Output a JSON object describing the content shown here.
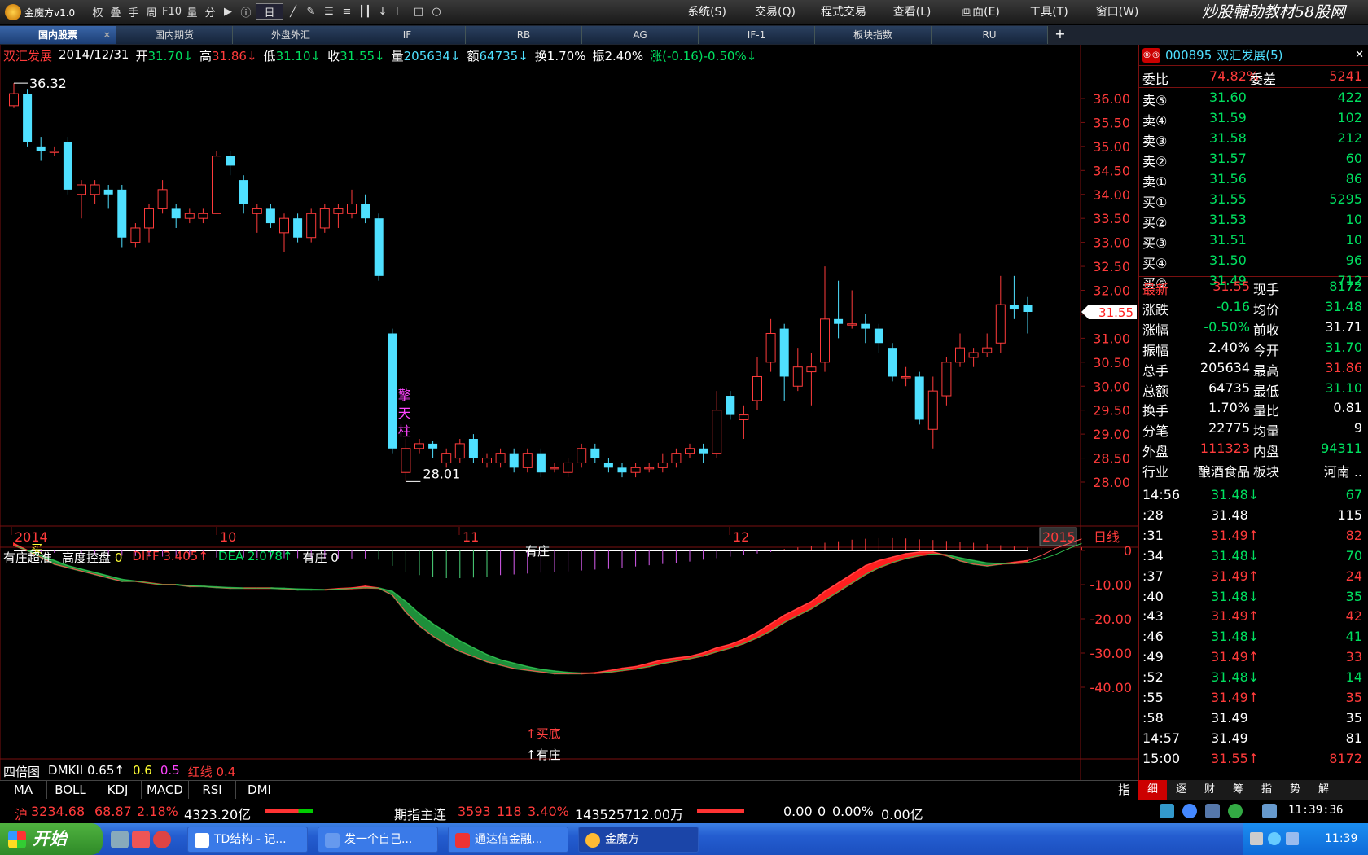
{
  "app": {
    "title": "金魔方v1.0",
    "brand": "炒股輔助教材58股网 www.58Gu.com"
  },
  "toolbar": {
    "items": [
      "权",
      "叠",
      "手",
      "周",
      "F10",
      "量",
      "分",
      "停",
      "选",
      "十"
    ],
    "cycle": "日"
  },
  "menus": [
    "系统(S)",
    "交易(Q)",
    "程式交易",
    "查看(L)",
    "画面(E)",
    "工具(T)",
    "窗口(W)"
  ],
  "tabs": [
    "国内股票",
    "国内期货",
    "外盘外汇",
    "IF",
    "RB",
    "AG",
    "IF-1",
    "板块指数",
    "RU"
  ],
  "info": {
    "stock": "双汇发展",
    "date": "2014/12/31",
    "open_l": "开",
    "open": "31.70↓",
    "high_l": "高",
    "high": "31.86↓",
    "low_l": "低",
    "low": "31.10↓",
    "close_l": "收",
    "close": "31.55↓",
    "vol_l": "量",
    "vol": "205634↓",
    "amt_l": "额",
    "amt": "64735↓",
    "turn_l": "换",
    "turn": "1.70%",
    "amp_l": "振",
    "amp": "2.40%",
    "chg": "涨(-0.16)-0.50%↓"
  },
  "annotations": {
    "max": "36.32",
    "min": "28.01",
    "qt_chars": [
      "擎",
      "天",
      "柱"
    ],
    "last_price": "31.55",
    "youzhuang": "有庄",
    "maidi": "↑买底",
    "youzhuang2": "↑有庄",
    "mai": "买"
  },
  "chart_data": {
    "type": "candlestick",
    "ylim": [
      28.0,
      36.5
    ],
    "y_ticks": [
      "36.00",
      "35.50",
      "35.00",
      "34.50",
      "34.00",
      "33.50",
      "33.00",
      "32.50",
      "32.00",
      "31.50",
      "31.00",
      "30.50",
      "30.00",
      "29.50",
      "29.00",
      "28.50",
      "28.00"
    ],
    "x_labels": [
      "2014",
      "10",
      "11",
      "12",
      "2015"
    ],
    "period": "日线",
    "candles": [
      [
        35.85,
        36.1,
        36.32,
        35.8
      ],
      [
        36.1,
        35.1,
        36.2,
        35.0
      ],
      [
        35.0,
        34.9,
        35.2,
        34.7
      ],
      [
        34.9,
        34.9,
        35.0,
        34.8
      ],
      [
        35.1,
        34.1,
        35.2,
        34.0
      ],
      [
        34.0,
        34.2,
        34.3,
        33.5
      ],
      [
        34.0,
        34.2,
        34.3,
        33.8
      ],
      [
        34.1,
        34.0,
        34.2,
        33.7
      ],
      [
        34.1,
        33.1,
        34.2,
        32.9
      ],
      [
        33.0,
        33.3,
        33.4,
        32.9
      ],
      [
        33.3,
        33.7,
        33.8,
        33.0
      ],
      [
        33.7,
        34.1,
        34.3,
        33.6
      ],
      [
        33.7,
        33.5,
        33.8,
        33.3
      ],
      [
        33.5,
        33.6,
        33.7,
        33.4
      ],
      [
        33.5,
        33.6,
        33.7,
        33.4
      ],
      [
        33.6,
        34.8,
        34.9,
        33.6
      ],
      [
        34.8,
        34.6,
        34.9,
        34.4
      ],
      [
        34.3,
        33.8,
        34.4,
        33.6
      ],
      [
        33.6,
        33.7,
        33.8,
        33.2
      ],
      [
        33.7,
        33.4,
        33.8,
        33.3
      ],
      [
        33.2,
        33.5,
        33.6,
        32.8
      ],
      [
        33.5,
        33.1,
        33.6,
        33.0
      ],
      [
        33.1,
        33.6,
        33.7,
        33.0
      ],
      [
        33.3,
        33.7,
        33.8,
        33.2
      ],
      [
        33.6,
        33.7,
        33.8,
        33.3
      ],
      [
        33.6,
        33.8,
        34.1,
        33.5
      ],
      [
        33.8,
        33.5,
        34.0,
        33.4
      ],
      [
        33.5,
        32.3,
        33.6,
        32.2
      ],
      [
        31.1,
        28.7,
        31.2,
        28.6
      ],
      [
        28.2,
        28.7,
        28.9,
        28.01
      ],
      [
        28.7,
        28.8,
        28.9,
        28.6
      ],
      [
        28.8,
        28.7,
        28.85,
        28.5
      ],
      [
        28.4,
        28.6,
        28.7,
        28.3
      ],
      [
        28.5,
        28.8,
        28.9,
        28.4
      ],
      [
        28.9,
        28.5,
        29.0,
        28.4
      ],
      [
        28.4,
        28.5,
        28.6,
        28.3
      ],
      [
        28.4,
        28.6,
        28.7,
        28.3
      ],
      [
        28.6,
        28.3,
        28.7,
        28.2
      ],
      [
        28.3,
        28.6,
        28.7,
        28.2
      ],
      [
        28.6,
        28.2,
        28.7,
        28.1
      ],
      [
        28.3,
        28.3,
        28.4,
        28.2
      ],
      [
        28.2,
        28.4,
        28.5,
        28.1
      ],
      [
        28.4,
        28.7,
        28.8,
        28.3
      ],
      [
        28.7,
        28.5,
        28.8,
        28.4
      ],
      [
        28.4,
        28.3,
        28.5,
        28.2
      ],
      [
        28.3,
        28.2,
        28.4,
        28.1
      ],
      [
        28.2,
        28.3,
        28.4,
        28.1
      ],
      [
        28.3,
        28.3,
        28.4,
        28.2
      ],
      [
        28.3,
        28.4,
        28.6,
        28.2
      ],
      [
        28.4,
        28.6,
        28.7,
        28.3
      ],
      [
        28.6,
        28.7,
        28.8,
        28.5
      ],
      [
        28.7,
        28.6,
        28.8,
        28.4
      ],
      [
        28.6,
        29.5,
        29.9,
        28.5
      ],
      [
        29.8,
        29.4,
        29.9,
        29.3
      ],
      [
        29.3,
        29.4,
        29.6,
        28.9
      ],
      [
        29.7,
        30.2,
        30.6,
        29.5
      ],
      [
        30.5,
        31.1,
        31.4,
        30.3
      ],
      [
        31.2,
        30.2,
        31.3,
        29.7
      ],
      [
        30.0,
        30.4,
        30.8,
        29.9
      ],
      [
        30.3,
        30.4,
        30.7,
        29.6
      ],
      [
        30.5,
        31.4,
        32.5,
        30.3
      ],
      [
        31.4,
        31.3,
        32.2,
        31.0
      ],
      [
        31.3,
        31.3,
        32.0,
        31.2
      ],
      [
        31.3,
        31.2,
        31.5,
        30.9
      ],
      [
        31.2,
        30.9,
        31.3,
        30.7
      ],
      [
        30.8,
        30.2,
        30.9,
        30.1
      ],
      [
        30.2,
        30.2,
        30.4,
        30.0
      ],
      [
        30.2,
        29.3,
        30.3,
        29.2
      ],
      [
        29.1,
        29.9,
        30.2,
        28.7
      ],
      [
        29.8,
        30.5,
        30.6,
        29.6
      ],
      [
        30.5,
        30.8,
        31.1,
        30.4
      ],
      [
        30.6,
        30.7,
        30.8,
        30.4
      ],
      [
        30.7,
        30.8,
        31.1,
        30.6
      ],
      [
        30.9,
        31.7,
        32.3,
        30.7
      ],
      [
        31.7,
        31.6,
        32.3,
        31.4
      ],
      [
        31.7,
        31.55,
        31.86,
        31.1
      ]
    ]
  },
  "indicator": {
    "name": "有庄超准",
    "p1_l": "高度控盘",
    "p1": "0",
    "diff_l": "DIFF",
    "diff": "3.405↑",
    "dea_l": "DEA",
    "dea": "2.078↑",
    "yz_l": "有庄",
    "yz": "0",
    "y_ticks": [
      "0",
      "-10.00",
      "-20.00",
      "-30.00",
      "-40.00"
    ],
    "diff_series": [
      2,
      0,
      -2,
      -4,
      -5,
      -6,
      -7,
      -8,
      -9,
      -9,
      -9.5,
      -10,
      -10,
      -10.5,
      -10.5,
      -10.8,
      -11,
      -11,
      -11,
      -11,
      -11.2,
      -11.5,
      -11.5,
      -11.5,
      -11.2,
      -11,
      -10.5,
      -11,
      -13,
      -18,
      -22,
      -25,
      -27.5,
      -29.5,
      -31,
      -32.5,
      -33.5,
      -34.5,
      -35,
      -35.5,
      -36,
      -36,
      -36,
      -35.8,
      -35.2,
      -34.5,
      -34,
      -33,
      -32,
      -31.5,
      -31,
      -30,
      -28.5,
      -27.5,
      -26,
      -24,
      -21.5,
      -19,
      -17,
      -15,
      -12,
      -9.5,
      -7,
      -4.5,
      -3,
      -2,
      -1,
      -0.5,
      -0.5,
      -1.5,
      -3,
      -4,
      -4.5,
      -4,
      -3.5,
      -3,
      -1.5,
      0.5,
      2,
      3.4
    ],
    "dea_series": [
      1.5,
      0,
      -1.5,
      -3,
      -4.5,
      -5.5,
      -6.5,
      -7.5,
      -8.5,
      -9,
      -9.5,
      -10,
      -10,
      -10.3,
      -10.5,
      -10.7,
      -10.9,
      -11,
      -11,
      -11,
      -11.1,
      -11.3,
      -11.4,
      -11.5,
      -11.3,
      -11.1,
      -10.9,
      -11,
      -12,
      -15,
      -18.5,
      -21.5,
      -24,
      -26.5,
      -28.5,
      -30.5,
      -32,
      -33,
      -34,
      -34.8,
      -35.3,
      -35.7,
      -35.9,
      -35.9,
      -35.6,
      -35.1,
      -34.6,
      -33.9,
      -33,
      -32.3,
      -31.6,
      -30.8,
      -29.6,
      -28.5,
      -27.2,
      -25.5,
      -23.5,
      -21,
      -19,
      -17,
      -14.5,
      -12,
      -9.5,
      -7,
      -5,
      -3.5,
      -2.3,
      -1.5,
      -1,
      -1.3,
      -2.2,
      -3,
      -3.7,
      -3.9,
      -3.8,
      -3.5,
      -2.6,
      -1.3,
      0.5,
      2.08
    ],
    "bars": [
      0,
      0,
      -0.5,
      -0.8,
      -1,
      -1.2,
      -1.5,
      -1.5,
      -1.7,
      -1.8,
      -2,
      -2,
      -2,
      -2.1,
      -2.2,
      -2.3,
      -2.3,
      -2.3,
      -2.4,
      -2.4,
      -2.5,
      -2.5,
      -2.6,
      -2.6,
      -2.6,
      -2.6,
      -2.6,
      -3,
      -5,
      -7,
      -8,
      -8.5,
      -9,
      -9,
      -8.8,
      -8.5,
      -8,
      -7.8,
      -7.5,
      -7.2,
      -7,
      -6.8,
      -6.5,
      -6.2,
      -6,
      -5.6,
      -5.2,
      -4.8,
      -4.4,
      -4,
      -3.6,
      -3,
      -2.5,
      -2,
      -1.5,
      -1,
      -0.5,
      0.5,
      1,
      1.5,
      2.5,
      3,
      3.5,
      3.8,
      4,
      4,
      3.9,
      3.6,
      3.4,
      3.1,
      2.8,
      2.5,
      2.1,
      1.7,
      1.3,
      1,
      0.8,
      0.6,
      0.8,
      1
    ]
  },
  "indicator2": {
    "name": "四倍图",
    "dmk_l": "DMKII",
    "dmk": "0.65↑",
    "v2": "0.6",
    "v3": "0.5",
    "hx_l": "红线",
    "hx": "0.4"
  },
  "ind_tabs": [
    "MA",
    "BOLL",
    "KDJ",
    "MACD",
    "RSI",
    "DMI"
  ],
  "ind_tab_zhi": "指",
  "quote": {
    "code": "000895",
    "name": "双汇发展(5)",
    "wb_l": "委比",
    "wb": "74.82%",
    "wc_l": "委差",
    "wc": "5241",
    "sells": [
      [
        "卖⑤",
        "31.60",
        "422"
      ],
      [
        "卖④",
        "31.59",
        "102"
      ],
      [
        "卖③",
        "31.58",
        "212"
      ],
      [
        "卖②",
        "31.57",
        "60"
      ],
      [
        "卖①",
        "31.56",
        "86"
      ]
    ],
    "buys": [
      [
        "买①",
        "31.55",
        "5295"
      ],
      [
        "买②",
        "31.53",
        "10"
      ],
      [
        "买③",
        "31.51",
        "10"
      ],
      [
        "买④",
        "31.50",
        "96"
      ],
      [
        "买⑤",
        "31.49",
        "712"
      ]
    ],
    "stats": [
      [
        "最新",
        "31.55",
        "现手",
        "8172"
      ],
      [
        "涨跌",
        "-0.16",
        "均价",
        "31.48"
      ],
      [
        "涨幅",
        "-0.50%",
        "前收",
        "31.71"
      ],
      [
        "振幅",
        "2.40%",
        "今开",
        "31.70"
      ],
      [
        "总手",
        "205634",
        "最高",
        "31.86"
      ],
      [
        "总额",
        "64735",
        "最低",
        "31.10"
      ],
      [
        "换手",
        "1.70%",
        "量比",
        "0.81"
      ],
      [
        "分笔",
        "22775",
        "均量",
        "9"
      ],
      [
        "外盘",
        "111323",
        "内盘",
        "94311"
      ],
      [
        "行业",
        "酿酒食品",
        "板块",
        "河南 .."
      ]
    ],
    "ticks": [
      [
        "14:56",
        "31.48↓",
        "67"
      ],
      [
        ":28",
        "31.48",
        "115"
      ],
      [
        ":31",
        "31.49↑",
        "82"
      ],
      [
        ":34",
        "31.48↓",
        "70"
      ],
      [
        ":37",
        "31.49↑",
        "24"
      ],
      [
        ":40",
        "31.48↓",
        "35"
      ],
      [
        ":43",
        "31.49↑",
        "42"
      ],
      [
        ":46",
        "31.48↓",
        "41"
      ],
      [
        ":49",
        "31.49↑",
        "33"
      ],
      [
        ":52",
        "31.48↓",
        "14"
      ],
      [
        ":55",
        "31.49↑",
        "35"
      ],
      [
        ":58",
        "31.49",
        "35"
      ],
      [
        "14:57",
        "31.49",
        "81"
      ],
      [
        "15:00",
        "31.55↑",
        "8172"
      ]
    ],
    "tabs": [
      "细",
      "逐",
      "财",
      "筹",
      "指",
      "势",
      "解"
    ]
  },
  "statusbar": {
    "sh_l": "沪",
    "sh": "3234.68",
    "sh_chg": "68.87",
    "sh_pct": "2.18%",
    "sh_amt": "4323.20亿",
    "fut_l": "期指主连",
    "fut": "3593",
    "fut_chg": "118",
    "fut_pct": "3.40%",
    "fut_amt": "143525712.00万",
    "r1": "0.00",
    "r2": "0",
    "r3": "0.00%",
    "r4": "0.00亿",
    "time": "11:39:36"
  },
  "taskbar": {
    "start": "开始",
    "tasks": [
      "TD结构 - 记...",
      "发一个自己...",
      "通达信金融...",
      "金魔方"
    ],
    "clock": "11:39"
  },
  "colors": {
    "up": "#ff3b3b",
    "down": "#4fe0ff",
    "green": "#00e060",
    "bg": "#000000",
    "grid": "#7a1010"
  }
}
